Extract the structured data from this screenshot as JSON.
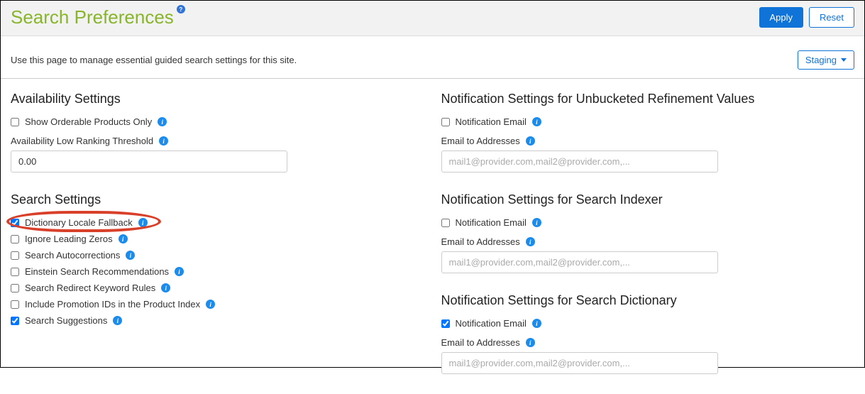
{
  "header": {
    "title": "Search Preferences",
    "apply_label": "Apply",
    "reset_label": "Reset"
  },
  "subheader": {
    "description": "Use this page to manage essential guided search settings for this site.",
    "env_dropdown_label": "Staging"
  },
  "left": {
    "availability": {
      "heading": "Availability Settings",
      "show_orderable_only": "Show Orderable Products Only",
      "low_ranking_label": "Availability Low Ranking Threshold",
      "low_ranking_value": "0.00"
    },
    "search": {
      "heading": "Search Settings",
      "items": [
        {
          "label": "Dictionary Locale Fallback",
          "checked": true
        },
        {
          "label": "Ignore Leading Zeros",
          "checked": false
        },
        {
          "label": "Search Autocorrections",
          "checked": false
        },
        {
          "label": "Einstein Search Recommendations",
          "checked": false
        },
        {
          "label": "Search Redirect Keyword Rules",
          "checked": false
        },
        {
          "label": "Include Promotion IDs in the Product Index",
          "checked": false
        },
        {
          "label": "Search Suggestions",
          "checked": true
        }
      ]
    }
  },
  "right": {
    "unbucketed": {
      "heading": "Notification Settings for Unbucketed Refinement Values",
      "notification_email_label": "Notification Email",
      "notification_email_checked": false,
      "email_to_label": "Email to Addresses",
      "email_placeholder": "mail1@provider.com,mail2@provider.com,..."
    },
    "indexer": {
      "heading": "Notification Settings for Search Indexer",
      "notification_email_label": "Notification Email",
      "notification_email_checked": false,
      "email_to_label": "Email to Addresses",
      "email_placeholder": "mail1@provider.com,mail2@provider.com,..."
    },
    "dictionary": {
      "heading": "Notification Settings for Search Dictionary",
      "notification_email_label": "Notification Email",
      "notification_email_checked": true,
      "email_to_label": "Email to Addresses",
      "email_placeholder": "mail1@provider.com,mail2@provider.com,..."
    }
  }
}
